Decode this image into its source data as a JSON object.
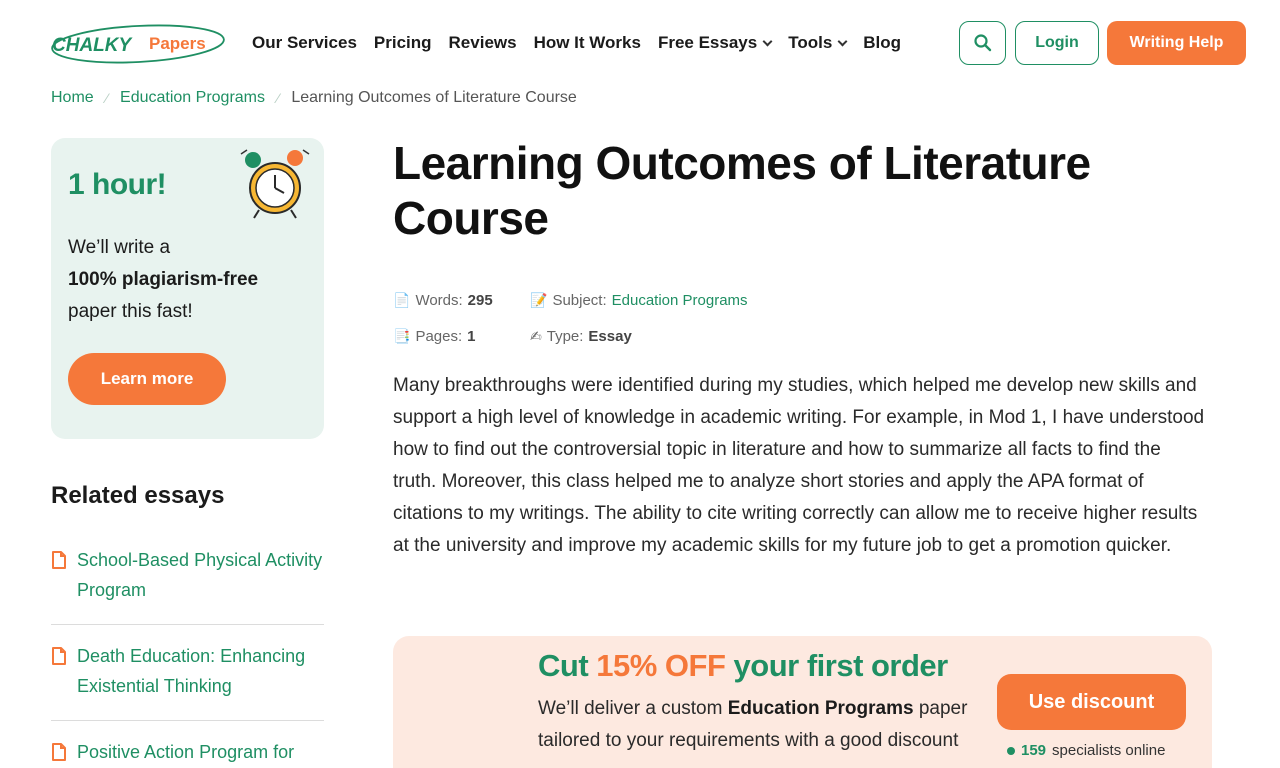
{
  "header": {
    "logo_text_part1": "CHALKY",
    "logo_text_part2": "Papers",
    "nav": [
      {
        "label": "Our Services"
      },
      {
        "label": "Pricing"
      },
      {
        "label": "Reviews"
      },
      {
        "label": "How It Works"
      },
      {
        "label": "Free Essays"
      },
      {
        "label": "Tools"
      },
      {
        "label": "Blog"
      }
    ],
    "login_label": "Login",
    "help_label": "Writing Help",
    "search_icon": "search-icon"
  },
  "breadcrumb": {
    "home": "Home",
    "category": "Education Programs",
    "current": "Learning Outcomes of Literature Course"
  },
  "promo": {
    "title": "1 hour!",
    "line1": "We’ll write a",
    "line2_bold": "100% plagiarism-free",
    "line3": "paper this fast!",
    "button": "Learn more",
    "icon": "alarm-clock-icon"
  },
  "related": {
    "title": "Related essays",
    "items": [
      {
        "label": "School-Based Physical Activity Program"
      },
      {
        "label": "Death Education: Enhancing Existential Thinking"
      },
      {
        "label": "Positive Action Program for"
      }
    ]
  },
  "article": {
    "title": "Learning Outcomes of Literature Course",
    "meta": {
      "words_label": "Words:",
      "words_value": "295",
      "subject_label": "Subject:",
      "subject_value": "Education Programs",
      "pages_label": "Pages:",
      "pages_value": "1",
      "type_label": "Type:",
      "type_value": "Essay"
    },
    "body": "Many breakthroughs were identified during my studies, which helped me develop new skills and support a high level of knowledge in academic writing. For example, in Mod 1, I have understood how to find out the controversial topic in literature and how to summarize all facts to find the truth. Moreover, this class helped me to analyze short stories and apply the APA format of citations to my writings. The ability to cite writing correctly can allow me to receive higher results at the university and improve my academic skills for my future job to get a promotion quicker."
  },
  "discount": {
    "title_part1": "Cut ",
    "title_accent": "15% OFF",
    "title_part2": " your first order",
    "text_part1": "We’ll deliver a custom ",
    "text_bold": "Education Programs",
    "text_part2": " paper tailored to your requirements with a good discount",
    "button": "Use discount",
    "online_count": "159",
    "online_label": "specialists online"
  },
  "colors": {
    "brand_green": "#1f8f63",
    "accent_orange": "#f5783a",
    "promo_bg": "#e8f3ef",
    "discount_bg": "#fde9e0"
  }
}
